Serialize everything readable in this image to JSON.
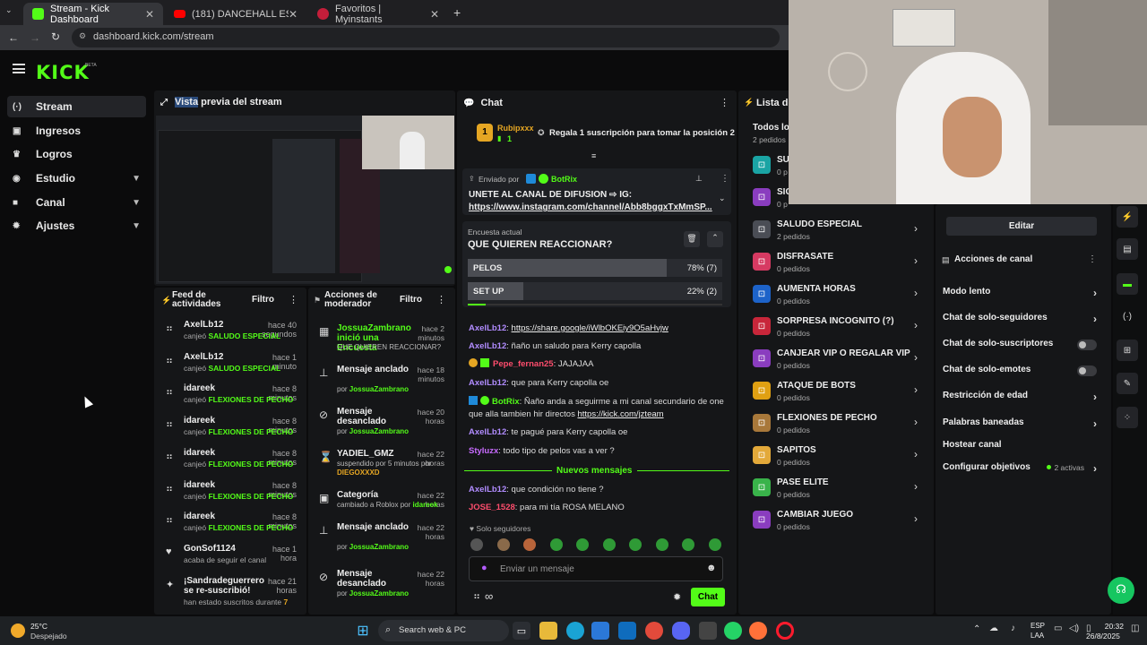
{
  "browser": {
    "tabs": [
      {
        "title": "Stream - Kick Dashboard",
        "icon": "kick-favicon-icon"
      },
      {
        "title": "(181) DANCEHALL ESMERALDE",
        "icon": "youtube-favicon-icon"
      },
      {
        "title": "Favoritos | Myinstants",
        "icon": "myinstants-favicon-icon"
      }
    ],
    "url": "dashboard.kick.com/stream"
  },
  "brand": {
    "logo": "KICK",
    "beta": "BETA",
    "accent": "#53fc18"
  },
  "sidebar": {
    "items": [
      {
        "label": "Stream",
        "icon": "broadcast-icon"
      },
      {
        "label": "Ingresos",
        "icon": "wallet-icon"
      },
      {
        "label": "Logros",
        "icon": "trophy-icon"
      },
      {
        "label": "Estudio",
        "icon": "camera-icon"
      },
      {
        "label": "Canal",
        "icon": "video-icon"
      },
      {
        "label": "Ajustes",
        "icon": "gear-icon"
      }
    ]
  },
  "preview": {
    "title_highlight": "Vista",
    "title_rest": " previa del stream"
  },
  "feed": {
    "title": "Feed de actividades",
    "filter": "Filtro",
    "items": [
      {
        "user": "AxelLb12",
        "time": "hace 40 segundos",
        "action": "canjeó",
        "reward": "SALUDO ESPECIAL"
      },
      {
        "user": "AxelLb12",
        "time": "hace 1 minuto",
        "action": "canjeó",
        "reward": "SALUDO ESPECIAL"
      },
      {
        "user": "idareek",
        "time": "hace 8 minutos",
        "action": "canjeó",
        "reward": "FLEXIONES DE PECHO"
      },
      {
        "user": "idareek",
        "time": "hace 8 minutos",
        "action": "canjeó",
        "reward": "FLEXIONES DE PECHO"
      },
      {
        "user": "idareek",
        "time": "hace 8 minutos",
        "action": "canjeó",
        "reward": "FLEXIONES DE PECHO"
      },
      {
        "user": "idareek",
        "time": "hace 8 minutos",
        "action": "canjeó",
        "reward": "FLEXIONES DE PECHO"
      },
      {
        "user": "idareek",
        "time": "hace 8 minutos",
        "action": "canjeó",
        "reward": "FLEXIONES DE PECHO"
      },
      {
        "user": "GonSof1124",
        "time": "hace 1 hora",
        "action": "acaba de seguir el canal",
        "reward": ""
      },
      {
        "user": "¡Sandradeguerrero se re-suscribió!",
        "time": "hace 21 horas",
        "action": "han estado suscritos durante",
        "reward": "7"
      }
    ]
  },
  "modactions": {
    "title": "Acciones de moderador",
    "filter": "Filtro",
    "items": [
      {
        "name": "JossuaZambrano inició una Encuesta",
        "time": "hace 2 minutos",
        "detail": "QUE QUIEREN REACCIONAR?",
        "by": ""
      },
      {
        "name": "Mensaje anclado",
        "time": "hace 18 minutos",
        "detail": "por",
        "by": "JossuaZambrano"
      },
      {
        "name": "Mensaje desanclado",
        "time": "hace 20 horas",
        "detail": "por",
        "by": "JossuaZambrano"
      },
      {
        "name": "YADIEL_GMZ",
        "time": "hace 22 horas",
        "detail": "suspendido por 5 minutos por",
        "by": "DIEGOXXXD"
      },
      {
        "name": "Categoría",
        "time": "hace 22 horas",
        "detail": "cambiado a Roblox por",
        "by": "idareek"
      },
      {
        "name": "Mensaje anclado",
        "time": "hace 22 horas",
        "detail": "por",
        "by": "JossuaZambrano"
      },
      {
        "name": "Mensaje desanclado",
        "time": "hace 22 horas",
        "detail": "por",
        "by": "JossuaZambrano"
      }
    ]
  },
  "chat": {
    "title": "Chat",
    "gift": {
      "rank": "1",
      "user": "Rubipxxx",
      "count": "1",
      "text": "Regala 1 suscripción para tomar la posición 2"
    },
    "pinned": {
      "sent_by": "Enviado por",
      "author": "BotRix",
      "text": "UNETE AL CANAL DE DIFUSION ⇨ IG:",
      "link": "https://www.instagram.com/channel/Abb8bggxTxMmSP..."
    },
    "poll": {
      "label": "Encuesta actual",
      "question": "QUE QUIEREN REACCIONAR?",
      "options": [
        {
          "label": "PELOS",
          "result": "78% (7)",
          "pct": 78
        },
        {
          "label": "SET UP",
          "result": "22% (2)",
          "pct": 22
        }
      ]
    },
    "messages": [
      {
        "user": "AxelLb12",
        "color": "#b18cff",
        "text": "",
        "link": "https://share.google/iWlbOKEiy9O5aHvjw"
      },
      {
        "user": "AxelLb12",
        "color": "#b18cff",
        "text": "ñaño un saludo para Kerry capolla",
        "link": ""
      },
      {
        "user": "Pepe_fernan25",
        "color": "#ff4d6d",
        "text": "JAJAJAA",
        "link": ""
      },
      {
        "user": "AxelLb12",
        "color": "#b18cff",
        "text": "que para Kerry capolla oe",
        "link": ""
      },
      {
        "user": "BotRix",
        "color": "#53fc18",
        "text": "Ñaño anda a seguirme a mi canal secundario de one que alla tambien hir directos",
        "link": "https://kick.com/jzteam"
      },
      {
        "user": "AxelLb12",
        "color": "#b18cff",
        "text": "te pagué para Kerry capolla oe",
        "link": ""
      },
      {
        "user": "Styluzx",
        "color": "#c86bff",
        "text": "todo tipo de pelos vas a ver ?",
        "link": ""
      }
    ],
    "new_messages": "Nuevos mensajes",
    "new": [
      {
        "user": "AxelLb12",
        "color": "#b18cff",
        "text": "que condición no tiene ?"
      },
      {
        "user": "JOSE_1528",
        "color": "#ff4d6d",
        "text": "para mi tía ROSA MELANO"
      }
    ],
    "followers_only": "Solo seguidores",
    "placeholder": "Enviar un mensaje",
    "send": "Chat",
    "infinity": "∞"
  },
  "rewards": {
    "title": "Lista de",
    "all": "Todos lo",
    "all_count": "2 pedidos",
    "items": [
      {
        "name": "SU",
        "count": "0 p",
        "color": "#1aa4a4"
      },
      {
        "name": "SIG",
        "count": "0 p",
        "color": "#8a3dbf"
      },
      {
        "name": "SALUDO ESPECIAL",
        "count": "2 pedidos",
        "color": "#4a4d55"
      },
      {
        "name": "DISFRASATE",
        "count": "0 pedidos",
        "color": "#d63a62"
      },
      {
        "name": "AUMENTA HORAS",
        "count": "0 pedidos",
        "color": "#1d63c9"
      },
      {
        "name": "SORPRESA INCOGNITO (?)",
        "count": "0 pedidos",
        "color": "#c8263a"
      },
      {
        "name": "CANJEAR VIP O REGALAR VIP",
        "count": "0 pedidos",
        "color": "#8a3dbf"
      },
      {
        "name": "ATAQUE DE BOTS",
        "count": "0 pedidos",
        "color": "#e0a012"
      },
      {
        "name": "FLEXIONES DE PECHO",
        "count": "0 pedidos",
        "color": "#a8783a"
      },
      {
        "name": "SAPITOS",
        "count": "0 pedidos",
        "color": "#e3a93a"
      },
      {
        "name": "PASE ELITE",
        "count": "0 pedidos",
        "color": "#39b34a"
      },
      {
        "name": "CAMBIAR JUEGO",
        "count": "0 pedidos",
        "color": "#8a3dbf"
      }
    ]
  },
  "channel": {
    "edit": "Editar",
    "actions_title": "Acciones de canal",
    "settings": [
      {
        "label": "Modo lento",
        "control": "arrow",
        "extra": ""
      },
      {
        "label": "Chat de solo-seguidores",
        "control": "arrow",
        "extra": ""
      },
      {
        "label": "Chat de solo-suscriptores",
        "control": "toggle",
        "extra": ""
      },
      {
        "label": "Chat de solo-emotes",
        "control": "toggle",
        "extra": ""
      },
      {
        "label": "Restricción de edad",
        "control": "arrow",
        "extra": ""
      },
      {
        "label": "Palabras baneadas",
        "control": "arrow",
        "extra": ""
      },
      {
        "label": "Hostear canal",
        "control": "none",
        "extra": ""
      },
      {
        "label": "Configurar objetivos",
        "control": "arrow",
        "extra": "2 activas"
      }
    ]
  },
  "taskbar": {
    "temp": "25°C",
    "weather": "Despejado",
    "search": "Search web & PC",
    "lang1": "ESP",
    "lang2": "LAA",
    "time": "20:32",
    "date": "26/8/2025"
  }
}
